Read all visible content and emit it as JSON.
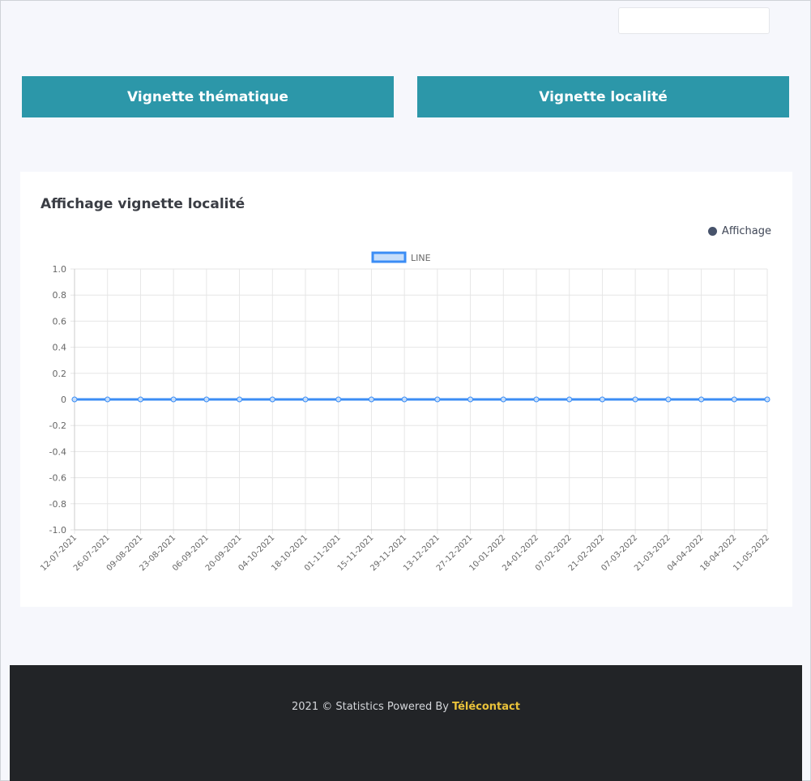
{
  "header": {
    "search_placeholder": ""
  },
  "tiles": {
    "thematic_label": "Vignette thématique",
    "locality_label": "Vignette localité"
  },
  "card": {
    "title": "Affichage vignette localité",
    "legend_label": "Affichage"
  },
  "colors": {
    "accent": "#2c97a9",
    "line": "#3b8df5",
    "line_fill": "#c7defa",
    "footer_bg": "#222427",
    "brand": "#e9c23a"
  },
  "chart_data": {
    "type": "line",
    "legend": "LINE",
    "x": [
      "12-07-2021",
      "26-07-2021",
      "09-08-2021",
      "23-08-2021",
      "06-09-2021",
      "20-09-2021",
      "04-10-2021",
      "18-10-2021",
      "01-11-2021",
      "15-11-2021",
      "29-11-2021",
      "13-12-2021",
      "27-12-2021",
      "10-01-2022",
      "24-01-2022",
      "07-02-2022",
      "21-02-2022",
      "07-03-2022",
      "21-03-2022",
      "04-04-2022",
      "18-04-2022",
      "11-05-2022"
    ],
    "series": [
      {
        "name": "LINE",
        "values": [
          0,
          0,
          0,
          0,
          0,
          0,
          0,
          0,
          0,
          0,
          0,
          0,
          0,
          0,
          0,
          0,
          0,
          0,
          0,
          0,
          0,
          0
        ]
      }
    ],
    "yticks": [
      "1.0",
      "0.8",
      "0.6",
      "0.4",
      "0.2",
      "0",
      "-0.2",
      "-0.4",
      "-0.6",
      "-0.8",
      "-1.0"
    ],
    "ylim": [
      -1,
      1
    ],
    "grid": true,
    "legend_position": "top-center"
  },
  "footer": {
    "text": "2021 © Statistics Powered By",
    "brand": "Télécontact"
  }
}
